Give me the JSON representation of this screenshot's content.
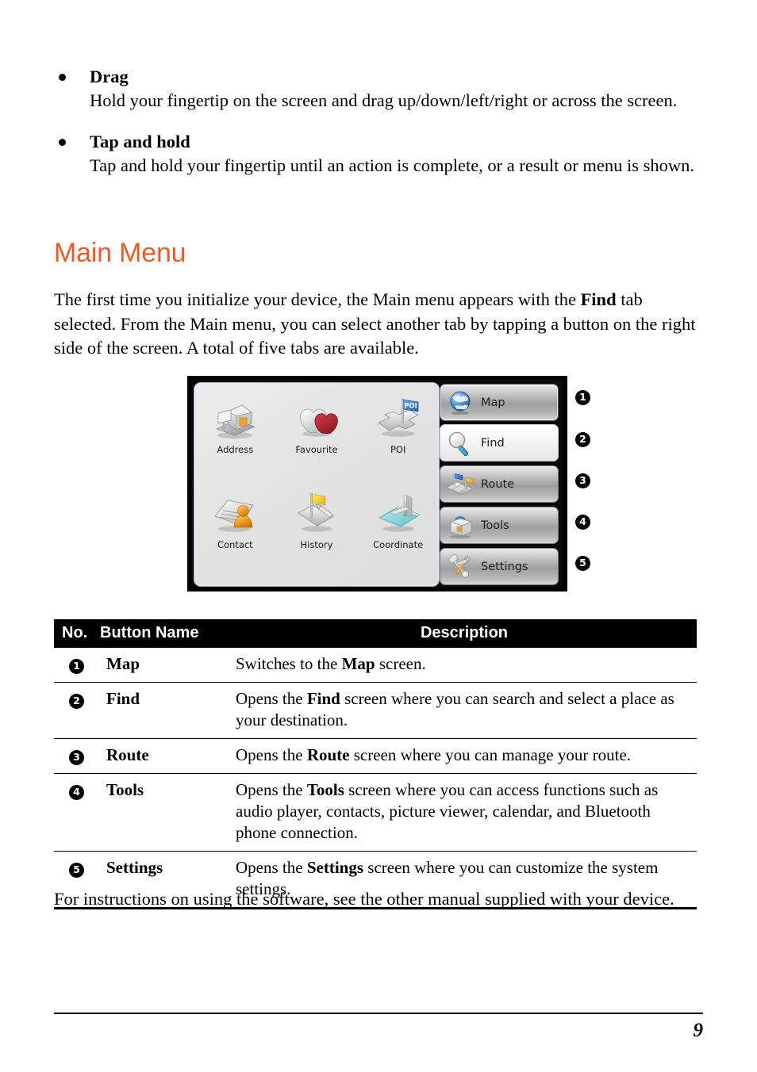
{
  "bullets": [
    {
      "title": "Drag",
      "body": "Hold your fingertip on the screen and drag up/down/left/right or across the screen."
    },
    {
      "title": "Tap and hold",
      "body": "Tap and hold your fingertip until an action is complete, or a result or menu is shown."
    }
  ],
  "heading": "Main Menu",
  "intro_paragraph_html": "The first time you initialize your device, the Main menu appears with the <b>Find</b> tab selected. From the Main menu, you can select another tab by tapping a button on the right side of the screen. A total of five tabs are available.",
  "device": {
    "icon_grid": [
      {
        "label": "Address",
        "icon": "house-on-map-icon"
      },
      {
        "label": "Favourite",
        "icon": "two-hearts-icon"
      },
      {
        "label": "POI",
        "icon": "poi-flag-crossroads-icon"
      },
      {
        "label": "Contact",
        "icon": "contact-card-person-icon"
      },
      {
        "label": "History",
        "icon": "flag-and-pen-icon"
      },
      {
        "label": "Coordinate",
        "icon": "coordinate-axes-plane-icon"
      }
    ],
    "tabs": [
      {
        "label": "Map",
        "icon": "globe-icon",
        "state": "normal",
        "callout": "❶"
      },
      {
        "label": "Find",
        "icon": "magnifier-icon",
        "state": "selected",
        "callout": "❷"
      },
      {
        "label": "Route",
        "icon": "route-flags-icon",
        "state": "normal",
        "callout": "❸"
      },
      {
        "label": "Tools",
        "icon": "toolbox-icon",
        "state": "normal",
        "callout": "❹"
      },
      {
        "label": "Settings",
        "icon": "hammer-wrench-icon",
        "state": "normal",
        "callout": "❺"
      }
    ],
    "callouts": [
      "1",
      "2",
      "3",
      "4",
      "5"
    ]
  },
  "table": {
    "headers": {
      "no": "No.",
      "name": "Button Name",
      "description": "Description"
    },
    "rows": [
      {
        "no": "1",
        "name": "Map",
        "description_html": "Switches to the <b>Map</b> screen."
      },
      {
        "no": "2",
        "name": "Find",
        "description_html": "Opens the <b>Find</b> screen where you can search and select a place as your destination."
      },
      {
        "no": "3",
        "name": "Route",
        "description_html": "Opens the <b>Route</b> screen where you can manage your route."
      },
      {
        "no": "4",
        "name": "Tools",
        "description_html": "Opens the <b>Tools</b> screen where you can access functions such as audio player, contacts, picture viewer, calendar, and Bluetooth phone connection."
      },
      {
        "no": "5",
        "name": "Settings",
        "description_html": "Opens the <b>Settings</b> screen where you can customize the system settings."
      }
    ]
  },
  "closing_paragraph": "For instructions on using the software, see the other manual supplied with your device.",
  "footer": {
    "page_number": "9"
  },
  "colors": {
    "heading_orange": "#ED5A28",
    "table_header_bg": "#000000",
    "table_header_fg": "#FFFFFF",
    "favourite_heart_red": "#B22234",
    "contact_person_orange": "#F0A22A",
    "history_flag_yellow": "#F5D13A",
    "coordinate_cyan": "#7FD4DE",
    "poi_flag_blue": "#2E7BD4",
    "route_flag_blue": "#2E7BD4",
    "route_flag_orange": "#F6A623"
  }
}
